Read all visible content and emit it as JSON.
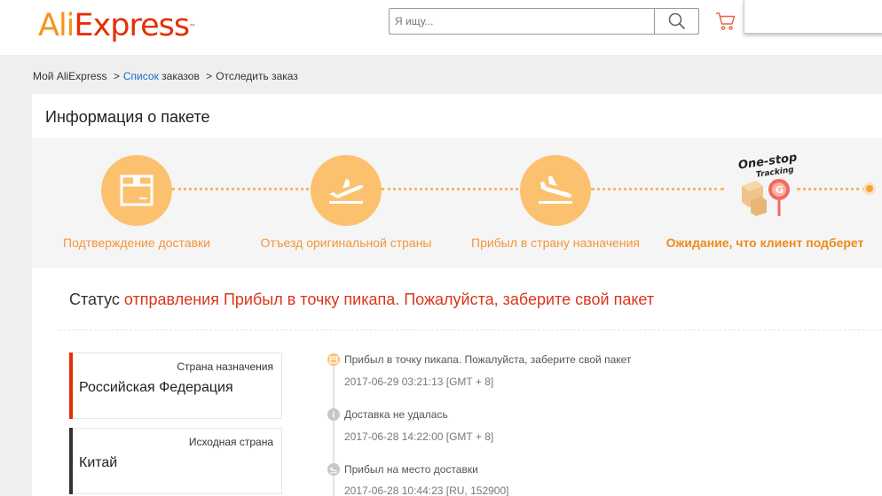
{
  "header": {
    "logo_part1": "Ali",
    "logo_part2": "Express",
    "logo_tm": "™",
    "search_placeholder": "Я ищу...",
    "search_icon": "search-icon",
    "cart_icon": "cart-icon",
    "brand_color": "#e62e04"
  },
  "breadcrumb": {
    "home": "Мой AliExpress",
    "sep1": ">",
    "orders_link": "Список",
    "orders_rest": "заказов",
    "sep2": ">",
    "current": "Отследить заказ"
  },
  "package": {
    "title": "Информация о пакете",
    "steps": [
      {
        "label": "Подтверждение доставки",
        "icon": "package-box-icon"
      },
      {
        "label": "Отъезд оригинальной страны",
        "icon": "plane-takeoff-icon"
      },
      {
        "label": "Прибыл в страну назначения",
        "icon": "plane-landing-icon"
      },
      {
        "label": "Ожидание, что клиент подберет",
        "icon": "one-stop-tracking-icon"
      }
    ],
    "onestop_line1": "One-stop",
    "onestop_line2": "Tracking",
    "accent_color": "#fcc16f",
    "label_color": "#f3963a"
  },
  "status": {
    "prefix": "Статус",
    "text": "отправления Прибыл в точку пикапа. Пожалуйста, заберите свой пакет",
    "color": "#d9361a"
  },
  "destination": {
    "caption": "Страна назначения",
    "value": "Российская Федерация",
    "bar_color": "#e62e04"
  },
  "origin": {
    "caption": "Исходная страна",
    "value": "Китай",
    "bar_color": "#333333"
  },
  "events": [
    {
      "text": "Прибыл в точку пикапа. Пожалуйста, заберите свой пакет",
      "time": "2017-06-29 03:21:13 [GMT + 8]",
      "icon": "pickup-point-icon"
    },
    {
      "text": "Доставка не удалась",
      "time": "2017-06-28 14:22:00 [GMT + 8]",
      "icon": "info-icon"
    },
    {
      "text": "Прибыл на место доставки",
      "time": "2017-06-28 10:44:23 [RU, 152900]",
      "icon": "plane-landing-icon"
    }
  ]
}
